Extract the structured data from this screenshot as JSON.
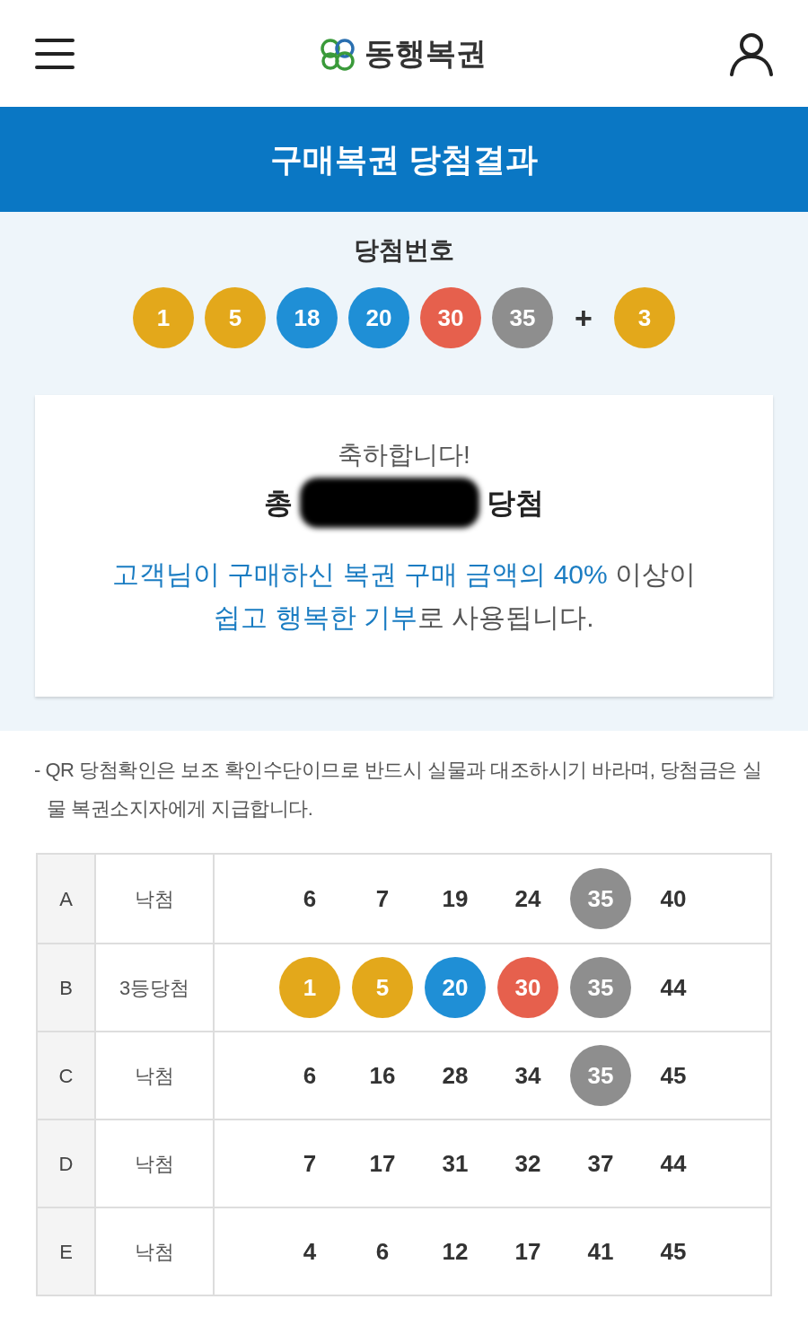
{
  "header": {
    "logo": "동행복권"
  },
  "banner": {
    "title": "구매복권 당첨결과"
  },
  "winning": {
    "label": "당첨번호",
    "plus": "+",
    "balls": [
      {
        "value": "1",
        "color": "#e3a81b"
      },
      {
        "value": "5",
        "color": "#e3a81b"
      },
      {
        "value": "18",
        "color": "#1f8fd6"
      },
      {
        "value": "20",
        "color": "#1f8fd6"
      },
      {
        "value": "30",
        "color": "#e6604d"
      },
      {
        "value": "35",
        "color": "#8e8e8e"
      }
    ],
    "bonus_ball": {
      "value": "3",
      "color": "#e3a81b"
    }
  },
  "result_card": {
    "greeting": "축하합니다!",
    "total_prefix": "총",
    "total_suffix": "당첨",
    "amount_redacted": true,
    "message_lines": [
      [
        {
          "text": "고객님이 구매하신 복권 구매 금액의 40%",
          "highlight": true
        },
        {
          "text": " 이상이",
          "highlight": false
        }
      ],
      [
        {
          "text": "쉽고 행복한 기부",
          "highlight": true
        },
        {
          "text": "로 사용됩니다.",
          "highlight": false
        }
      ]
    ]
  },
  "note": "- QR 당첨확인은 보조 확인수단이므로 반드시 실물과 대조하시기 바라며, 당첨금은 실물 복권소지자에게 지급합니다.",
  "table": {
    "rows": [
      {
        "game": "A",
        "result": "낙첨",
        "numbers": [
          {
            "value": "6"
          },
          {
            "value": "7"
          },
          {
            "value": "19"
          },
          {
            "value": "24"
          },
          {
            "value": "35",
            "color": "#8e8e8e"
          },
          {
            "value": "40"
          }
        ]
      },
      {
        "game": "B",
        "result": "3등당첨",
        "numbers": [
          {
            "value": "1",
            "color": "#e3a81b"
          },
          {
            "value": "5",
            "color": "#e3a81b"
          },
          {
            "value": "20",
            "color": "#1f8fd6"
          },
          {
            "value": "30",
            "color": "#e6604d"
          },
          {
            "value": "35",
            "color": "#8e8e8e"
          },
          {
            "value": "44"
          }
        ]
      },
      {
        "game": "C",
        "result": "낙첨",
        "numbers": [
          {
            "value": "6"
          },
          {
            "value": "16"
          },
          {
            "value": "28"
          },
          {
            "value": "34"
          },
          {
            "value": "35",
            "color": "#8e8e8e"
          },
          {
            "value": "45"
          }
        ]
      },
      {
        "game": "D",
        "result": "낙첨",
        "numbers": [
          {
            "value": "7"
          },
          {
            "value": "17"
          },
          {
            "value": "31"
          },
          {
            "value": "32"
          },
          {
            "value": "37"
          },
          {
            "value": "44"
          }
        ]
      },
      {
        "game": "E",
        "result": "낙첨",
        "numbers": [
          {
            "value": "4"
          },
          {
            "value": "6"
          },
          {
            "value": "12"
          },
          {
            "value": "17"
          },
          {
            "value": "41"
          },
          {
            "value": "45"
          }
        ]
      }
    ]
  }
}
